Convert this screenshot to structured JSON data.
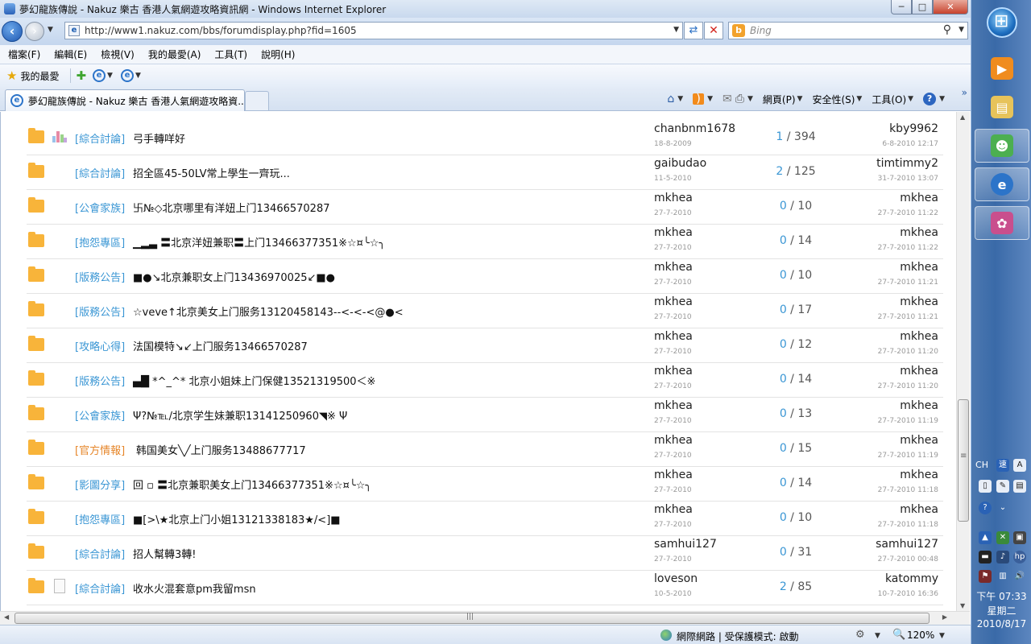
{
  "window": {
    "title": "夢幻龍族傳說 - Nakuz 樂古 香港人氣網遊攻略資訊網 - Windows Internet Explorer",
    "minimize": "─",
    "maximize": "□",
    "close": "✕"
  },
  "address": {
    "url": "http://www1.nakuz.com/bbs/forumdisplay.php?fid=1605",
    "search_placeholder": "Bing"
  },
  "menu": [
    "檔案(F)",
    "編輯(E)",
    "檢視(V)",
    "我的最愛(A)",
    "工具(T)",
    "說明(H)"
  ],
  "favorites": {
    "label": "我的最愛"
  },
  "tab": {
    "title": "夢幻龍族傳說 - Nakuz 樂古 香港人氣網遊攻略資..."
  },
  "commands": {
    "page": "網頁(P)",
    "safety": "安全性(S)",
    "tools": "工具(O)"
  },
  "threads": [
    {
      "icon": "poll",
      "category": "[綜合討論]",
      "title": "弓手轉咩好",
      "author": "chanbnm1678",
      "date": "18-8-2009",
      "replies": "1",
      "views": "394",
      "last_user": "kby9962",
      "last_date": "6-8-2010 12:17"
    },
    {
      "icon": "none",
      "category": "[綜合討論]",
      "title": "招全區45-50LV常上學生一齊玩...",
      "author": "gaibudao",
      "date": "11-5-2010",
      "replies": "2",
      "views": "125",
      "last_user": "timtimmy2",
      "last_date": "31-7-2010 13:07"
    },
    {
      "icon": "none",
      "category": "[公會家族]",
      "title": "卐№◇北京哪里有洋妞上门13466570287",
      "author": "mkhea",
      "date": "27-7-2010",
      "replies": "0",
      "views": "10",
      "last_user": "mkhea",
      "last_date": "27-7-2010 11:22"
    },
    {
      "icon": "none",
      "category": "[抱怨專區]",
      "title": "▁▂▃ 〓北京洋妞兼职〓上门13466377351※☆¤╰☆╮",
      "author": "mkhea",
      "date": "27-7-2010",
      "replies": "0",
      "views": "14",
      "last_user": "mkhea",
      "last_date": "27-7-2010 11:22"
    },
    {
      "icon": "none",
      "category": "[版務公告]",
      "title": "■●↘北京兼职女上门13436970025↙■●",
      "author": "mkhea",
      "date": "27-7-2010",
      "replies": "0",
      "views": "10",
      "last_user": "mkhea",
      "last_date": "27-7-2010 11:21"
    },
    {
      "icon": "none",
      "category": "[版務公告]",
      "title": "☆veve↑北京美女上门服务13120458143--<-<-<@●<",
      "author": "mkhea",
      "date": "27-7-2010",
      "replies": "0",
      "views": "17",
      "last_user": "mkhea",
      "last_date": "27-7-2010 11:21"
    },
    {
      "icon": "none",
      "category": "[攻略心得]",
      "title": "法国模特↘↙上门服务13466570287",
      "author": "mkhea",
      "date": "27-7-2010",
      "replies": "0",
      "views": "12",
      "last_user": "mkhea",
      "last_date": "27-7-2010 11:20"
    },
    {
      "icon": "none",
      "category": "[版務公告]",
      "title": "▄█ *^_^* 北京小姐妹上门保健13521319500＜※",
      "author": "mkhea",
      "date": "27-7-2010",
      "replies": "0",
      "views": "14",
      "last_user": "mkhea",
      "last_date": "27-7-2010 11:20"
    },
    {
      "icon": "none",
      "category": "[公會家族]",
      "title": "Ψ?№℡/北京学生妹兼职13141250960◥※ Ψ",
      "author": "mkhea",
      "date": "27-7-2010",
      "replies": "0",
      "views": "13",
      "last_user": "mkhea",
      "last_date": "27-7-2010 11:19"
    },
    {
      "icon": "none",
      "category": "[官方情報]",
      "title": "韩国美女╲╱上门服务13488677717",
      "author": "mkhea",
      "date": "27-7-2010",
      "replies": "0",
      "views": "15",
      "last_user": "mkhea",
      "last_date": "27-7-2010 11:19"
    },
    {
      "icon": "none",
      "category": "[影圖分享]",
      "title": "回 ▫ 〓北京兼职美女上门13466377351※☆¤╰☆╮",
      "author": "mkhea",
      "date": "27-7-2010",
      "replies": "0",
      "views": "14",
      "last_user": "mkhea",
      "last_date": "27-7-2010 11:18"
    },
    {
      "icon": "none",
      "category": "[抱怨專區]",
      "title": "■[>\\★北京上门小姐13121338183★/<]■",
      "author": "mkhea",
      "date": "27-7-2010",
      "replies": "0",
      "views": "10",
      "last_user": "mkhea",
      "last_date": "27-7-2010 11:18"
    },
    {
      "icon": "none",
      "category": "[綜合討論]",
      "title": "招人幫轉3轉!",
      "author": "samhui127",
      "date": "27-7-2010",
      "replies": "0",
      "views": "31",
      "last_user": "samhui127",
      "last_date": "27-7-2010 00:48"
    },
    {
      "icon": "doc",
      "category": "[綜合討論]",
      "title": "收水火混套意pm我留msn",
      "author": "loveson",
      "date": "10-5-2010",
      "replies": "2",
      "views": "85",
      "last_user": "katommy",
      "last_date": "10-7-2010 16:36"
    }
  ],
  "status": {
    "zone": "網際網路 | 受保護模式: 啟動",
    "zoom": "120%"
  },
  "tray": {
    "lang": "CH",
    "time": "下午 07:33",
    "weekday": "星期二",
    "date": "2010/8/17"
  },
  "colors": {
    "category": "#3a96d4",
    "category_official": "#e6862a",
    "folder": "#f8b43a"
  }
}
